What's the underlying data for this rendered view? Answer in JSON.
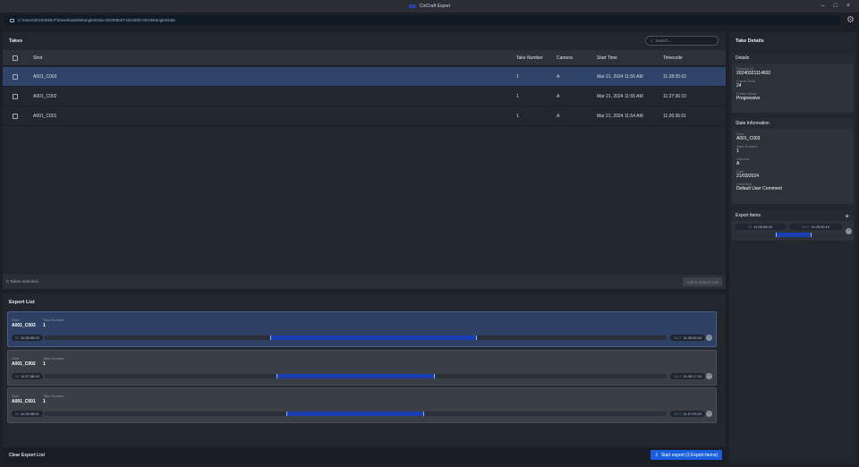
{
  "app": {
    "title": "CinCraft Export",
    "path": "C:\\Users\\ZOJDEMUT\\Downloads\\WranglerData-20240502T162459Z-001\\WranglerData"
  },
  "icons": {
    "folder": "folder-icon",
    "gear": "gear-icon",
    "search": "search-icon",
    "remove": "minus-circle-icon",
    "add": "plus-icon",
    "export": "export-icon"
  },
  "colors": {
    "accent": "#1a5fe0",
    "selected_row": "#2f4468",
    "range": "#1a3fb5"
  },
  "takes": {
    "title": "Takes",
    "search_placeholder": "Search...",
    "columns": [
      "Shot",
      "Take Number",
      "Camera",
      "Start Time",
      "Timecode"
    ],
    "rows": [
      {
        "shot": "A001_C003",
        "take": "1",
        "camera": "A",
        "start": "Mar 21, 2024 11:56 AM",
        "timecode": "11:28:35:02",
        "selected": true
      },
      {
        "shot": "A001_C002",
        "take": "1",
        "camera": "A",
        "start": "Mar 21, 2024 11:55 AM",
        "timecode": "11:27:36:10",
        "selected": false
      },
      {
        "shot": "A001_C001",
        "take": "1",
        "camera": "A",
        "start": "Mar 21, 2024 11:54 AM",
        "timecode": "11:26:36:01",
        "selected": false
      }
    ],
    "status": "0 Takes selected",
    "add_button": "Add to Export List"
  },
  "export_list": {
    "title": "Export List",
    "shot_label": "Shot",
    "take_label": "Take Number",
    "in_label": "IN",
    "out_label": "OUT",
    "items": [
      {
        "shot": "A001_C003",
        "take": "1",
        "in": "11:28:35:02",
        "out": "11:29:30:10",
        "range": [
          0.363,
          0.696
        ],
        "selected": true
      },
      {
        "shot": "A001_C002",
        "take": "1",
        "in": "11:27:36:10",
        "out": "11:28:17:19",
        "range": [
          0.373,
          0.628
        ],
        "selected": false
      },
      {
        "shot": "A001_C001",
        "take": "1",
        "in": "11:26:36:01",
        "out": "11:27:09:22",
        "range": [
          0.39,
          0.611
        ],
        "selected": false
      }
    ],
    "clear_button": "Clear Export List",
    "start_button": "Start export (3 Export-Items)"
  },
  "details": {
    "title": "Take Details",
    "details_section": {
      "title": "Details",
      "fields": [
        {
          "k": "Session ID",
          "v": "20240321114602"
        },
        {
          "k": "Frame Rate",
          "v": "24"
        },
        {
          "k": "Frame Mode",
          "v": "Progressive"
        }
      ]
    },
    "slate_section": {
      "title": "Slate Information",
      "fields": [
        {
          "k": "Shot",
          "v": "A001_C003"
        },
        {
          "k": "Take Number",
          "v": "1"
        },
        {
          "k": "Camera",
          "v": "A"
        },
        {
          "k": "Date",
          "v": "21/03/2024"
        },
        {
          "k": "Comment",
          "v": "Default User Comment"
        }
      ]
    },
    "export_items": {
      "title": "Export Items",
      "add": "+",
      "in": "11:28:35:02",
      "out": "11:29:30:10",
      "range": [
        0.38,
        0.72
      ]
    }
  }
}
